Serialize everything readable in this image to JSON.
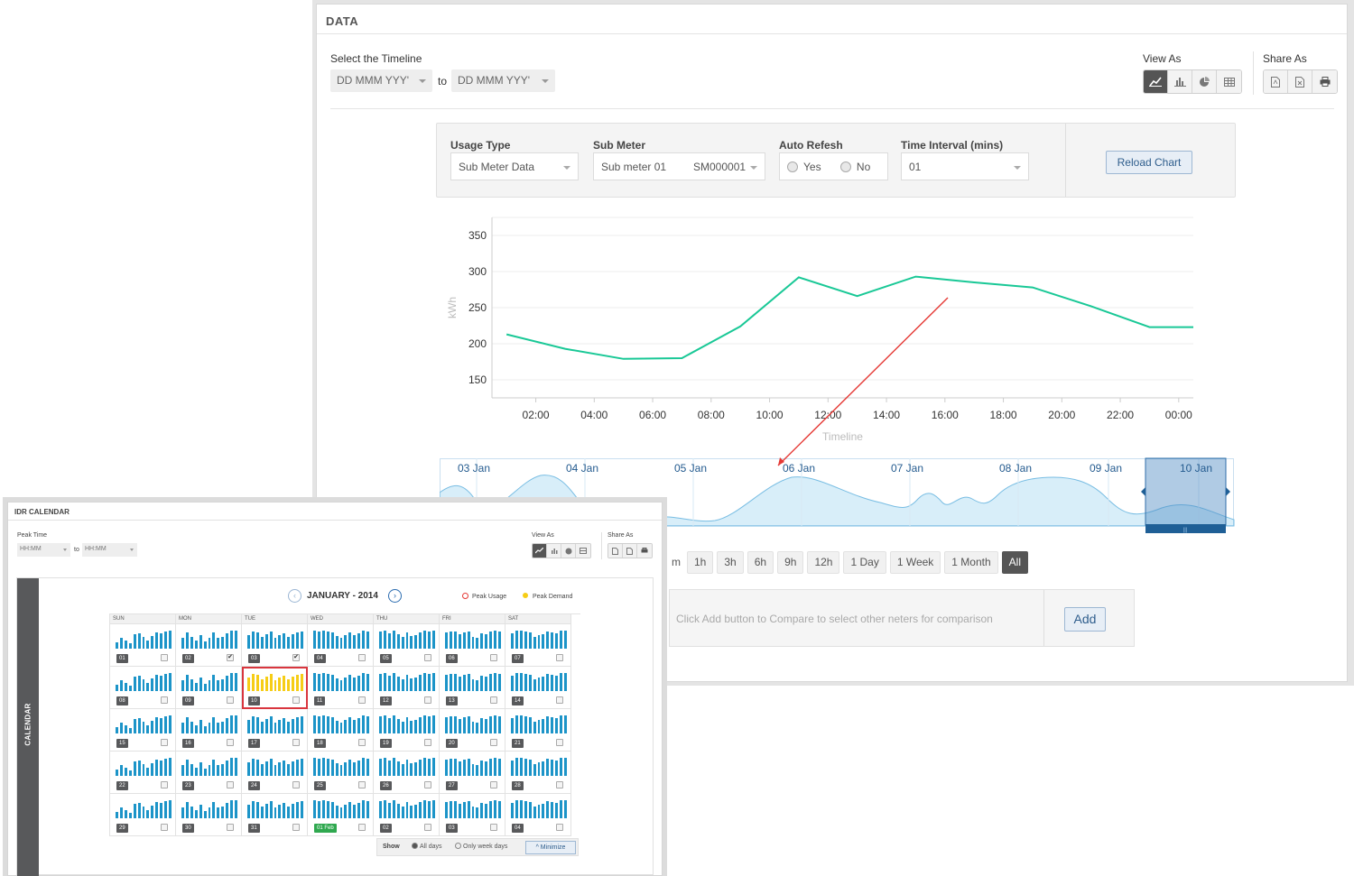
{
  "data_panel": {
    "title": "DATA",
    "timeline_label": "Select the Timeline",
    "from_placeholder": "DD MMM YYY'",
    "to_label": "to",
    "to_placeholder": "DD MMM YYY'",
    "view_as_label": "View As",
    "view_as_icons": [
      "line-chart-icon",
      "bar-chart-icon",
      "pie-chart-icon",
      "table-icon"
    ],
    "share_as_label": "Share As",
    "share_as_icons": [
      "pdf-icon",
      "excel-icon",
      "print-icon"
    ],
    "filters": {
      "usage_type_label": "Usage Type",
      "usage_type_value": "Sub Meter Data",
      "sub_meter_label": "Sub Meter",
      "sub_meter_value": "Sub meter 01",
      "sub_meter_code": "SM000001",
      "auto_refresh_label": "Auto Refesh",
      "auto_refresh_yes": "Yes",
      "auto_refresh_no": "No",
      "interval_label": "Time Interval (mins)",
      "interval_value": "01",
      "reload_label": "Reload Chart"
    },
    "navigator_dates": [
      "03 Jan",
      "04 Jan",
      "05 Jan",
      "06 Jan",
      "07 Jan",
      "08 Jan",
      "09 Jan",
      "10 Jan"
    ],
    "navigator_handle": "|||",
    "range_buttons": [
      "m",
      "1h",
      "3h",
      "6h",
      "9h",
      "12h",
      "1 Day",
      "1 Week",
      "1 Month",
      "All"
    ],
    "range_active": "All",
    "compare_text": "Click Add button to Compare to select other neters for comparison",
    "add_label": "Add",
    "colors": {
      "line": "#19c896",
      "navigator": "#a9d9f2",
      "active": "#555555",
      "arrow": "#e53935"
    }
  },
  "chart_data": {
    "type": "line",
    "title": "",
    "xlabel": "Timeline",
    "ylabel": "kWh",
    "ylim": [
      125,
      375
    ],
    "yticks": [
      150,
      200,
      250,
      300,
      350
    ],
    "xtick_labels": [
      "02:00",
      "04:00",
      "06:00",
      "08:00",
      "10:00",
      "12:00",
      "14:00",
      "16:00",
      "18:00",
      "20:00",
      "22:00",
      "00:00"
    ],
    "xticks": [
      2,
      4,
      6,
      8,
      10,
      12,
      14,
      16,
      18,
      20,
      22,
      24
    ],
    "xlim": [
      0.5,
      24.5
    ],
    "grid": true,
    "series": [
      {
        "x": [
          1,
          3,
          5,
          7,
          9,
          11,
          13,
          15,
          17,
          19,
          21,
          23,
          24.5
        ],
        "values": [
          213,
          193,
          179,
          180,
          224,
          292,
          266,
          293,
          285,
          278,
          252,
          223,
          223
        ]
      }
    ]
  },
  "calendar_panel": {
    "title": "IDR CALENDAR",
    "peak_time_label": "Peak Time",
    "from_placeholder": "HH:MM",
    "to_label": "to",
    "to_placeholder": "HH:MM",
    "view_as_label": "View As",
    "share_as_label": "Share As",
    "side_tab": "CALENDAR",
    "month_label": "JANUARY - 2014",
    "legend_peak_usage": "Peak Usage",
    "legend_peak_demand": "Peak Demand",
    "weekdays": [
      "SUN",
      "MON",
      "TUE",
      "WED",
      "THU",
      "FRI",
      "SAT"
    ],
    "days": [
      "01",
      "02",
      "03",
      "04",
      "05",
      "06",
      "07",
      "08",
      "09",
      "10",
      "11",
      "12",
      "13",
      "14",
      "15",
      "16",
      "17",
      "18",
      "19",
      "20",
      "21",
      "22",
      "23",
      "24",
      "25",
      "26",
      "27",
      "28",
      "29",
      "30",
      "31",
      "01 Feb",
      "02",
      "03",
      "04"
    ],
    "checked_days": [
      1,
      2
    ],
    "selected_day": 9,
    "next_month_day": 31,
    "show_label": "Show",
    "all_days_label": "All days",
    "week_days_label": "Only week days",
    "minimize_label": "^ Minimize",
    "colors": {
      "bar": "#1c94c8",
      "selected_bar": "#f6cd16",
      "selected_border": "#d9363e",
      "feb": "#2fa84f"
    }
  }
}
